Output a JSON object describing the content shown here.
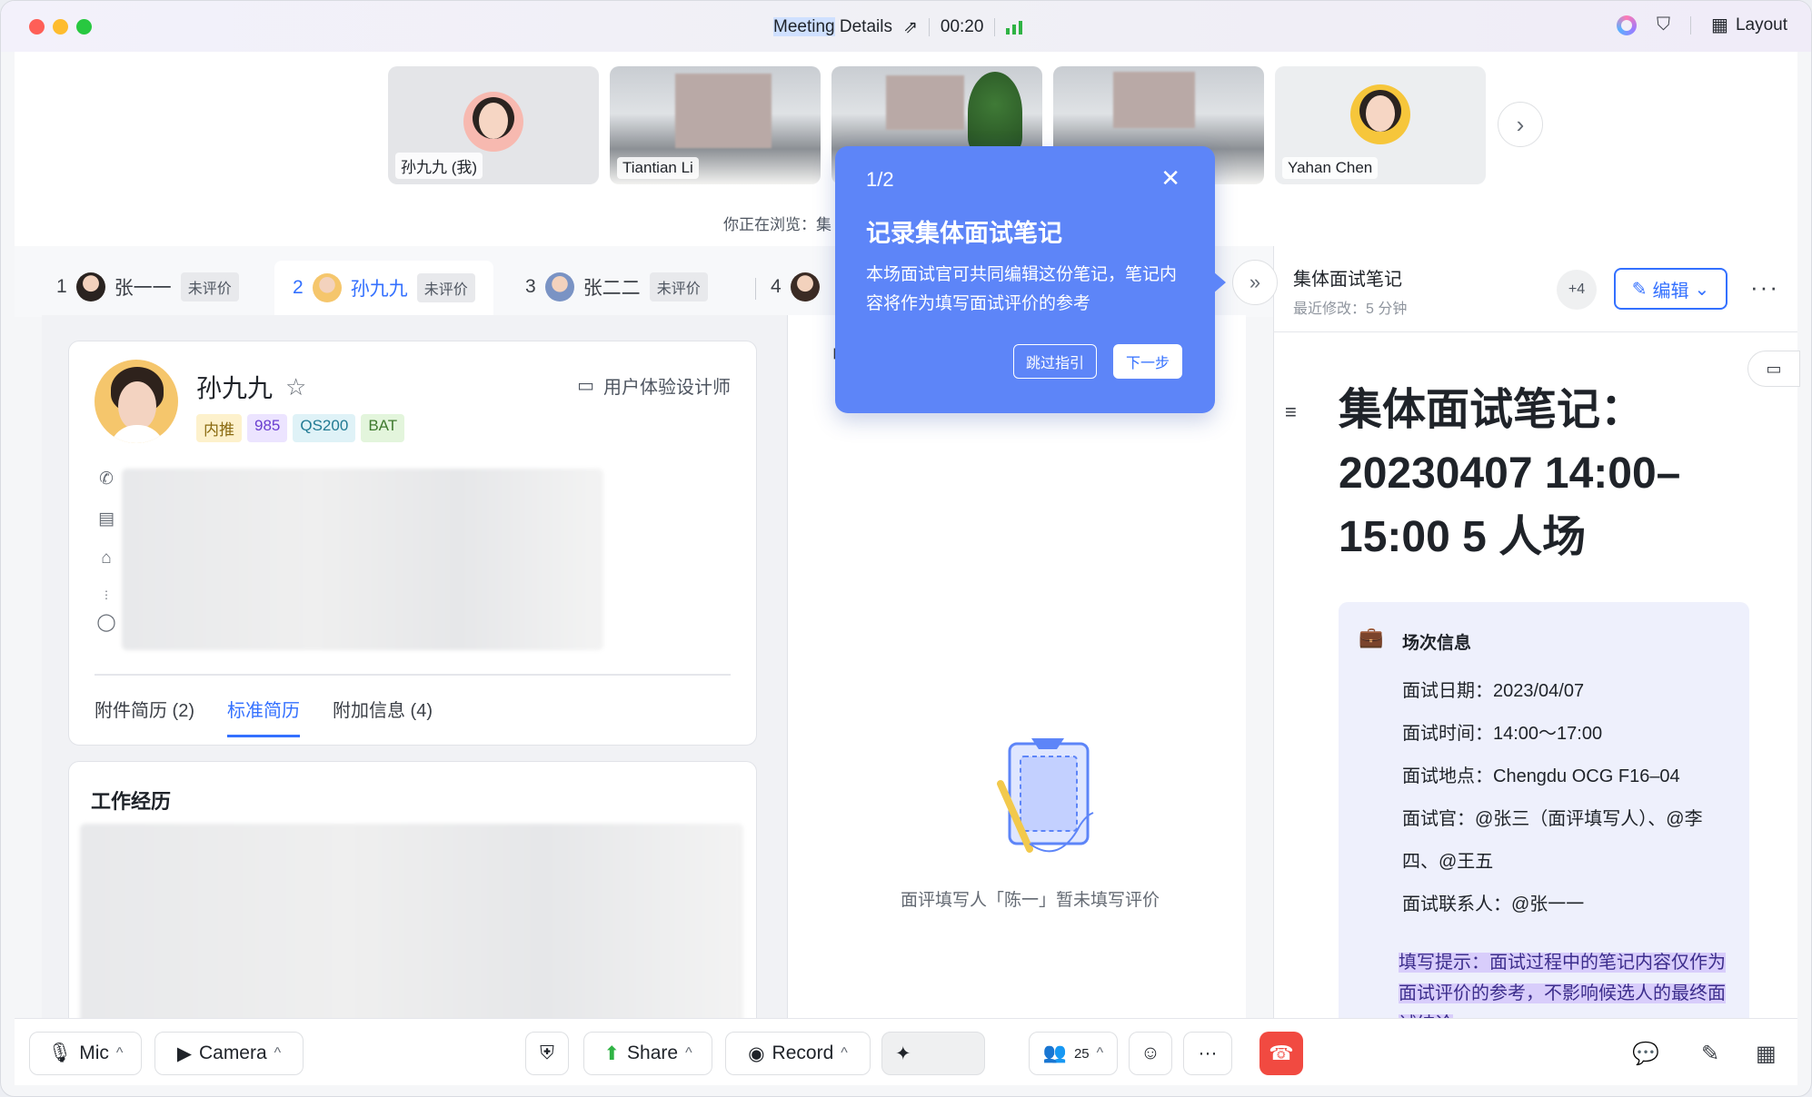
{
  "titlebar": {
    "meeting_word": "Meeting",
    "details_word": "Details",
    "timer": "00:20",
    "layout_label": "Layout"
  },
  "participants": [
    {
      "name": "孙九九 (我)"
    },
    {
      "name": "Tiantian Li"
    },
    {
      "name": ""
    },
    {
      "name": ""
    },
    {
      "name": "Yahan Chen"
    }
  ],
  "browsing_text": "你正在浏览：集",
  "candidate_tabs": [
    {
      "index": "1",
      "name": "张一一",
      "status": "未评价"
    },
    {
      "index": "2",
      "name": "孙九九",
      "status": "未评价"
    },
    {
      "index": "3",
      "name": "张二二",
      "status": "未评价"
    },
    {
      "index": "4",
      "name": "",
      "status": ""
    }
  ],
  "profile": {
    "name": "孙九九",
    "job_title": "用户体验设计师",
    "tags": [
      "内推",
      "985",
      "QS200",
      "BAT"
    ],
    "tabs": [
      "附件简历 (2)",
      "标准简历",
      "附加信息 (4)"
    ],
    "active_tab": "标准简历"
  },
  "work_section": {
    "title": "工作经历"
  },
  "middle": {
    "fragment": "「",
    "empty_text": "面评填写人「陈一」暂未填写评价"
  },
  "notes": {
    "title": "集体面试笔记",
    "last_modified": "最近修改：5 分钟",
    "collaborators_more": "+4",
    "edit_label": "编辑",
    "doc_title": "集体面试笔记：20230407 14:00–15:00 5 人场",
    "callout_heading": "场次信息",
    "rows": [
      "面试日期：2023/04/07",
      "面试时间：14:00～17:00",
      "面试地点：Chengdu OCG F16–04",
      "面试官：@张三（面评填写人）、@李四、@王五",
      "面试联系人：@张一一"
    ],
    "hint": "填写提示：面试过程中的笔记内容仅作为面试评价的参考，不影响候选人的最终面试结论"
  },
  "guide": {
    "step": "1/2",
    "title": "记录集体面试笔记",
    "description": "本场面试官可共同编辑这份笔记，笔记内容将作为填写面试评价的参考",
    "skip_label": "跳过指引",
    "next_label": "下一步"
  },
  "toolbar": {
    "mic_label": "Mic",
    "camera_label": "Camera",
    "share_label": "Share",
    "record_label": "Record",
    "participants_count": "25"
  },
  "colors": {
    "accent": "#3370ff",
    "guide_bg": "#5d85f8",
    "hangup": "#f14a41",
    "signal": "#2fb344"
  }
}
